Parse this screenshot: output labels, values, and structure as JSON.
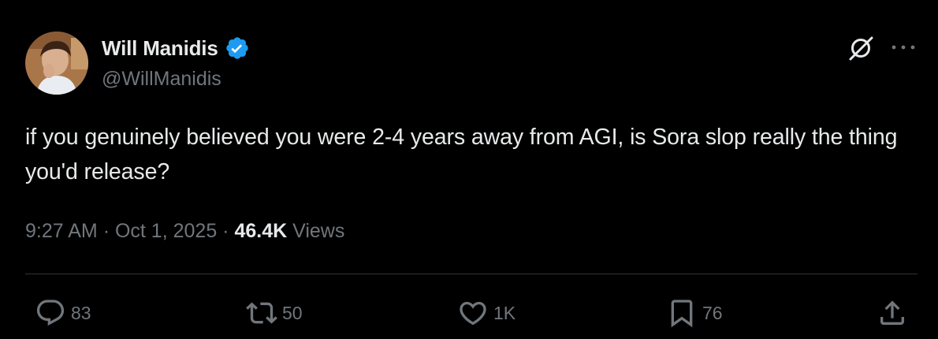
{
  "author": {
    "display_name": "Will Manidis",
    "handle": "@WillManidis",
    "verified": true
  },
  "tweet": {
    "text": "if you genuinely believed you were 2-4 years away from AGI, is Sora slop really the thing you'd release?",
    "time": "9:27 AM",
    "separator": "·",
    "date": "Oct 1, 2025",
    "views_count": "46.4K",
    "views_label": "Views"
  },
  "actions": {
    "replies": "83",
    "reposts": "50",
    "likes": "1K",
    "bookmarks": "76"
  },
  "colors": {
    "background": "#000000",
    "text_primary": "#e7e9ea",
    "text_secondary": "#71767b",
    "verified_blue": "#1d9bf0",
    "divider": "#2f3336"
  },
  "icons": {
    "verified": "verified-badge-icon",
    "grok": "grok-icon",
    "more": "more-icon",
    "reply": "reply-icon",
    "repost": "repost-icon",
    "like": "heart-icon",
    "bookmark": "bookmark-icon",
    "share": "share-icon"
  }
}
